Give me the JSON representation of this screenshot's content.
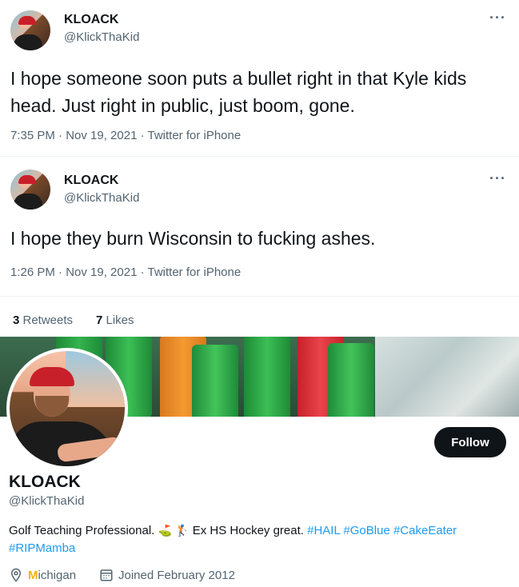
{
  "tweets": [
    {
      "author_name": "KLOACK",
      "author_handle": "@KlickThaKid",
      "more": "···",
      "text": "I hope someone soon puts a bullet right in that Kyle kids head. Just right in public, just boom, gone.",
      "meta": "7:35 PM · Nov 19, 2021 · Twitter for iPhone"
    },
    {
      "author_name": "KLOACK",
      "author_handle": "@KlickThaKid",
      "more": "···",
      "text": "I hope they burn Wisconsin to fucking ashes.",
      "meta": "1:26 PM · Nov 19, 2021 · Twitter for iPhone"
    }
  ],
  "stats": {
    "retweets_count": "3",
    "retweets_label": " Retweets",
    "likes_count": "7",
    "likes_label": " Likes"
  },
  "profile": {
    "name": "KLOACK",
    "handle": "@KlickThaKid",
    "follow_label": "Follow",
    "bio_prefix": "Golf Teaching Professional. ",
    "bio_emoji_1": "⛳",
    "bio_emoji_2": "🏌",
    "bio_middle": " Ex HS Hockey great. ",
    "hashtags": [
      "#HAIL",
      "#GoBlue",
      "#CakeEater",
      "#RIPMamba"
    ],
    "location_glyph": "M",
    "location_rest": "ichigan",
    "joined": "Joined February 2012"
  },
  "colors": {
    "accent": "#1d9bf0",
    "text_primary": "#0f1419",
    "text_secondary": "#536471",
    "follow_bg": "#0f1419"
  },
  "icons": {
    "more": "more-dots-icon",
    "location": "location-pin-icon",
    "calendar": "calendar-icon"
  }
}
